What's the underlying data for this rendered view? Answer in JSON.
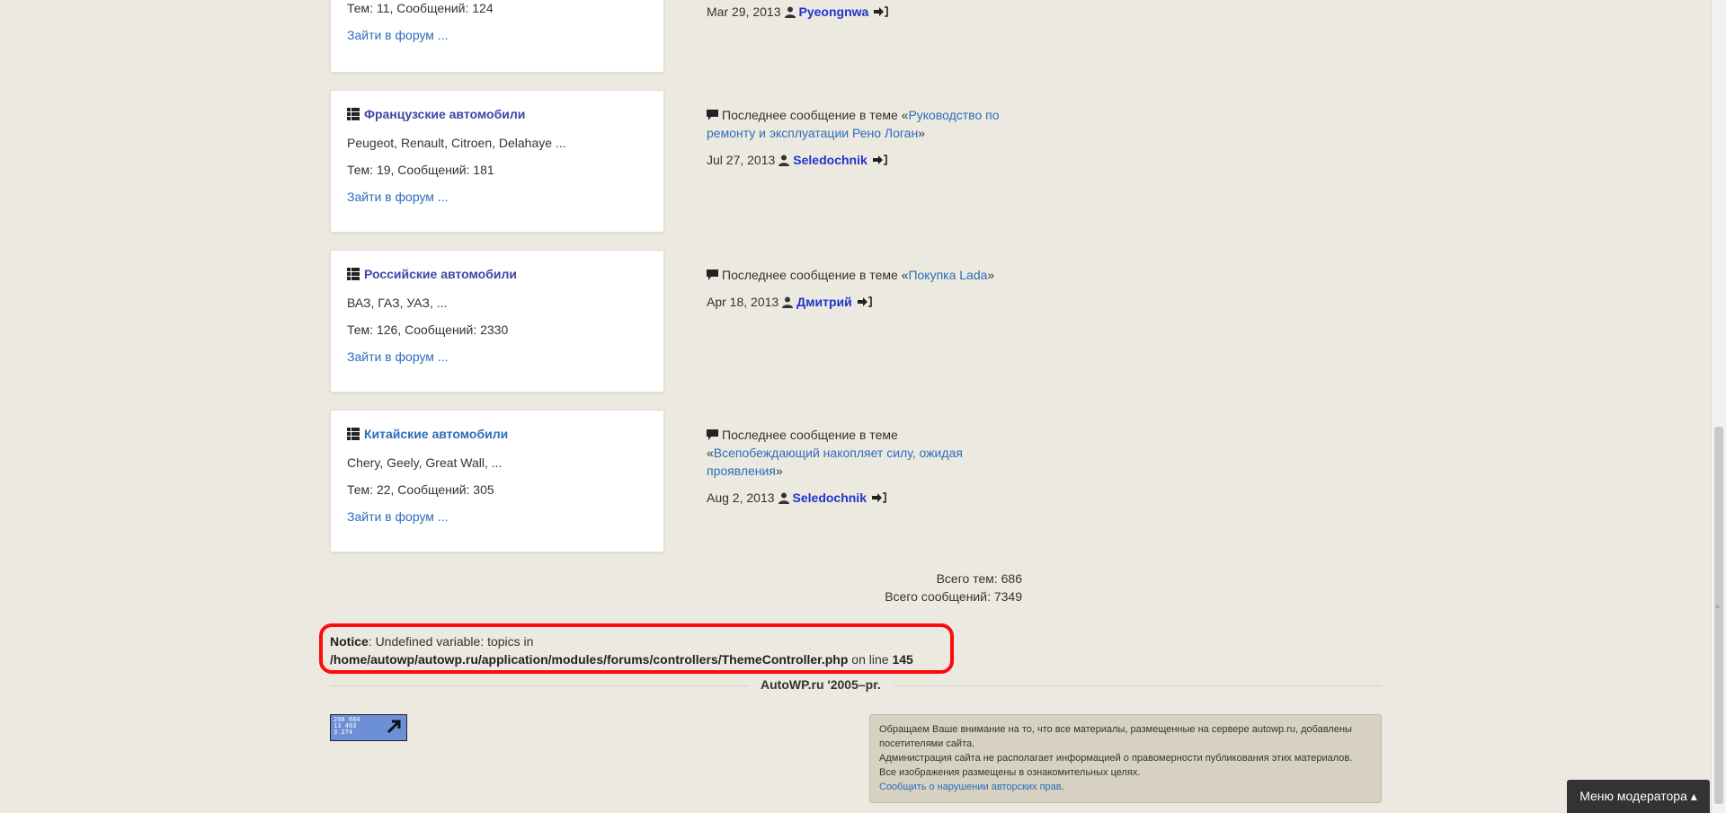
{
  "forums": [
    {
      "title": "",
      "desc": "",
      "stats": "Тем: 11, Сообщений: 124",
      "enter": "Зайти в форум ...",
      "last": {
        "prefix": "",
        "topic": "",
        "suffix": "",
        "date": "Mar 29, 2013",
        "user": "Pyeongnwa"
      }
    },
    {
      "title": "Французские автомобили",
      "desc": "Peugeot, Renault, Citroen, Delahaye ...",
      "stats": "Тем: 19, Сообщений: 181",
      "enter": "Зайти в форум ...",
      "last": {
        "prefix": "Последнее сообщение в теме «",
        "topic": "Руководство по ремонту и эксплуатации Рено Логан",
        "suffix": "»",
        "date": "Jul 27, 2013",
        "user": "Seledochnik"
      }
    },
    {
      "title": "Российские автомобили",
      "desc": "ВАЗ, ГАЗ, УАЗ, ...",
      "stats": "Тем: 126, Сообщений: 2330",
      "enter": "Зайти в форум ...",
      "last": {
        "prefix": "Последнее сообщение в теме «",
        "topic": "Покупка Lada",
        "suffix": "»",
        "date": "Apr 18, 2013",
        "user": "Дмитрий"
      }
    },
    {
      "title": "Китайские автомобили",
      "desc": "Chery, Geely, Great Wall, ...",
      "stats": "Тем: 22, Сообщений: 305",
      "enter": "Зайти в форум ...",
      "last": {
        "prefix": "Последнее сообщение в теме «",
        "topic": "Всепобеждающий накопляет силу, ожидая проявления",
        "suffix": "»",
        "date": "Aug 2, 2013",
        "user": "Seledochnik"
      }
    }
  ],
  "totals": {
    "topics": "Всего тем: 686",
    "messages": "Всего сообщений: 7349"
  },
  "notice": {
    "label": "Notice",
    "text": ": Undefined variable: topics in",
    "path": "/home/autowp/autowp.ru/application/modules/forums/controllers/ThemeController.php",
    "on_line": " on line ",
    "line": "145"
  },
  "footer": {
    "title": "AutoWP.ru '2005–pr.",
    "counter": [
      "298 684",
      "13 493",
      "3 274"
    ],
    "disclaimer": [
      "Обращаем Ваше внимание на то, что все материалы, размещенные на сервере autowp.ru, добавлены посетителями сайта.",
      "Администрация сайта не располагает информацией о правомерности публикования этих материалов.",
      "Все изображения размещены в ознакомительных целях."
    ],
    "report_link": "Сообщить о нарушении авторских прав"
  },
  "moderator_menu": "Меню модератора ▴",
  "icons": {
    "forum": "grid-icon",
    "message": "comment-icon",
    "user": "user-icon",
    "goto": "login-arrow-icon"
  },
  "colors": {
    "background": "#ece9e0",
    "link": "#2a6ebb",
    "forum_title": "#3a48a8",
    "user": "#2233cc",
    "notice_border": "#ff0a0a"
  }
}
